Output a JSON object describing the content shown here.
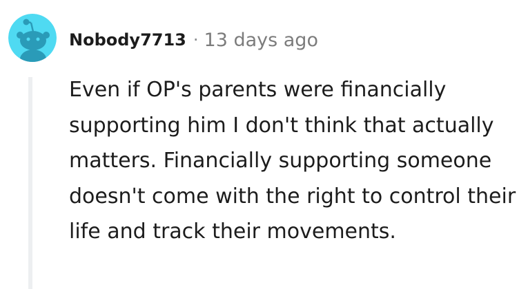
{
  "comment": {
    "author": "Nobody7713",
    "separator": "·",
    "timestamp": "13 days ago",
    "body": "Even if OP's parents were financially supporting him I don't think that actually matters. Financially supporting someone doesn't come with the right to control their life and track their movements."
  },
  "avatar": {
    "icon": "reddit-snoo-icon",
    "background_color": "#4fdaf2",
    "figure_color": "#2a9bb8"
  },
  "colors": {
    "text": "#1c1c1c",
    "meta": "#7c7c7c",
    "thread_line": "#edeff1"
  }
}
